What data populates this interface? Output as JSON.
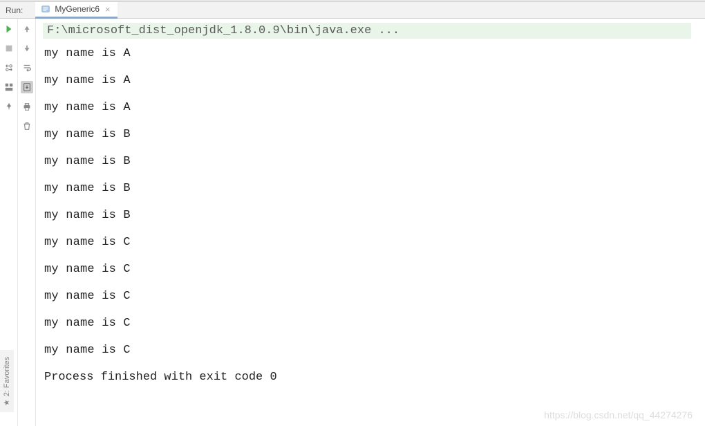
{
  "header": {
    "run_label": "Run:",
    "tab_name": "MyGeneric6"
  },
  "console": {
    "command": "F:\\microsoft_dist_openjdk_1.8.0.9\\bin\\java.exe ...",
    "output_lines": [
      "my name is A",
      "my name is A",
      "my name is A",
      "my name is B",
      "my name is B",
      "my name is B",
      "my name is B",
      "my name is C",
      "my name is C",
      "my name is C",
      "my name is C",
      "my name is C"
    ],
    "exit_message": "Process finished with exit code 0"
  },
  "side_tab": {
    "label": "2: Favorites"
  },
  "watermark": "https://blog.csdn.net/qq_44274276"
}
